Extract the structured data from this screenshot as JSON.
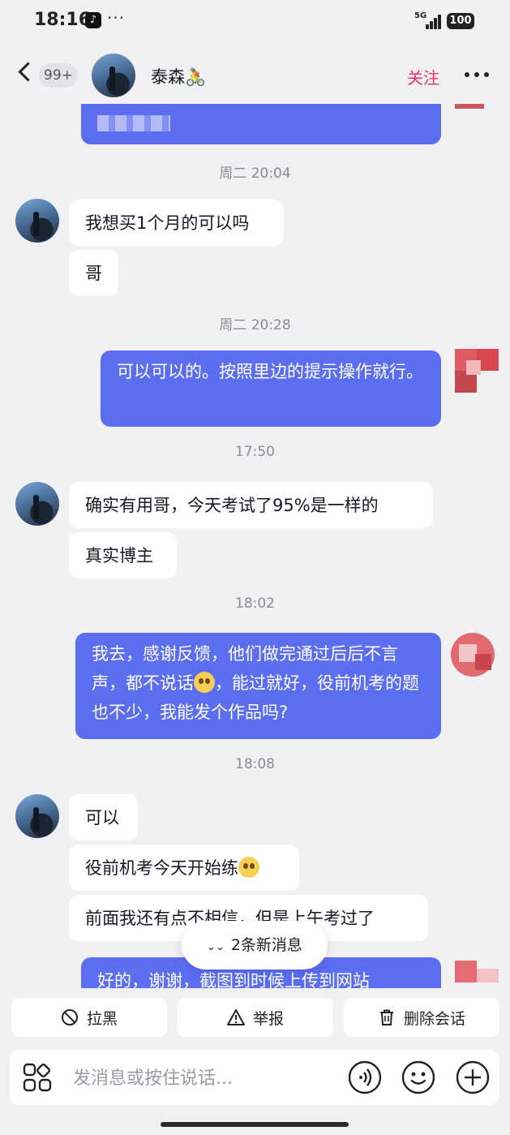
{
  "status_bar": {
    "time": "18:16",
    "app_glyph": "♪",
    "dots": "···",
    "network": "5G",
    "battery": "100"
  },
  "header": {
    "unread_count": "99+",
    "contact_name": "泰森🚴",
    "follow_label": "关注"
  },
  "messages": {
    "t1": "周二 20:04",
    "m1": "我想买1个月的可以吗",
    "m2": "哥",
    "t2": "周二 20:28",
    "m3": "可以可以的。按照里边的提示操作就行。",
    "t3": "17:50",
    "m4": "确实有用哥，今天考试了95%是一样的",
    "m5": "真实博主",
    "t4": "18:02",
    "m6a": "我去，感谢反馈，他们做完通过后后不言声，都不说话",
    "m6b": "，能过就好，役前机考的题也不少，我能发个作品吗?",
    "t5": "18:08",
    "m7": "可以",
    "m8": "役前机考今天开始练",
    "m9": "前面我还有点不相信，但是上午考过了",
    "m10": "好的，谢谢，截图到时候上传到网站"
  },
  "new_messages": {
    "label": "2条新消息"
  },
  "actions": {
    "block": "拉黑",
    "report": "举报",
    "delete": "删除会话"
  },
  "input": {
    "placeholder": "发消息或按住说话..."
  },
  "colors": {
    "accent": "#f2305e",
    "outgoing_bubble": "#5b6ef0",
    "background": "#f1f1f4"
  }
}
